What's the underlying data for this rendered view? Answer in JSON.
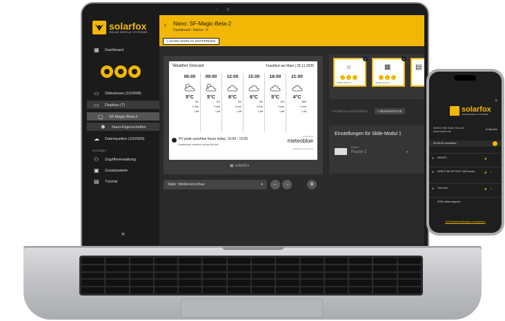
{
  "app": {
    "logo_word": "solarfox",
    "logo_sub": "SOLAR DISPLAY SYSTEMS",
    "brand_color": "#f2b705"
  },
  "sidebar": {
    "dashboard": "Dashboard",
    "slideshows": "Slideshows (10/2008)",
    "displays": "Displays (7)",
    "display_selected": "SF-Magic-Beta-2",
    "nano_props": "Nano-Eigenschaften",
    "datasources": "Datenquellen (10/2009)",
    "section_other": "Sonstiges",
    "access": "Zugriffsverwaltung",
    "packages": "Zusatzpakete",
    "tutorial": "Tutorial",
    "collapse": "«"
  },
  "header": {
    "back": "‹",
    "title": "Nano: SF-Magic-Beta-2",
    "breadcrumb": "Dashboard › Nanos › 9",
    "remove_button": "NANO-DISPLAY ENTFERNEN"
  },
  "weather": {
    "title": "Weather forecast",
    "location_date": "Frankfurt am Main | 25.11.2025",
    "columns": [
      {
        "time": "06:00",
        "temp": "5°C",
        "rain_pct": "0%",
        "rain_mm": "0 mm",
        "wind": "1 bft",
        "icon": "cloud-sun"
      },
      {
        "time": "09:00",
        "temp": "5°C",
        "rain_pct": "0%",
        "rain_mm": "0 mm",
        "wind": "1 bft",
        "icon": "cloud-sun"
      },
      {
        "time": "12:00",
        "temp": "6°C",
        "rain_pct": "0%",
        "rain_mm": "0 mm",
        "wind": "1 bft",
        "icon": "cloud"
      },
      {
        "time": "15:00",
        "temp": "6°C",
        "rain_pct": "0%",
        "rain_mm": "0 mm",
        "wind": "1 bft",
        "icon": "cloud"
      },
      {
        "time": "18:00",
        "temp": "5°C",
        "rain_pct": "0%",
        "rain_mm": "0 mm",
        "wind": "1 bft",
        "icon": "cloud"
      },
      {
        "time": "21:00",
        "temp": "4°C",
        "rain_pct": "25%",
        "rain_mm": "0 mm",
        "wind": "1 bft",
        "icon": "cloud"
      }
    ],
    "footer_main": "PV peak sunshine hours today: 10:00 - 15:00.",
    "footer_sub": "Quasitrange sunshine during this time",
    "provider_pre": "powered by",
    "provider": "meteoblue",
    "provider_sub": "A Meteoium Company",
    "frame_brand": "solarfox"
  },
  "controls": {
    "slide_select": "Slide: Wettervorschau",
    "slide_caret": "▾",
    "prev": "←",
    "next": "→",
    "present": "⧉"
  },
  "thumbnails": [
    {
      "badge": "1",
      "source": "Quelle: Demo 0",
      "symbol": "☼"
    },
    {
      "badge": "2",
      "source": "Quelle: Demo 2",
      "symbol": "▦"
    },
    {
      "badge": "",
      "source": "",
      "symbol": "▤"
    }
  ],
  "thumbnail_actions": {
    "add": "+ SLIDE(S) HINZUFÜGEN",
    "flow": "+ REIHENFOLGE"
  },
  "settings": {
    "title": "Einstellungen für Slide-Modul 1",
    "raster_label": "Raster *",
    "raster_value": "Raster 1",
    "raster_caret": "▾"
  },
  "phone": {
    "close": "×",
    "hint": "Weitere Hilfe finden Sie unter www.solarfox.de",
    "language": "⊕ Sprache",
    "wifi_select": "Mit WLAN auswählen",
    "networks": [
      {
        "name": "3934470",
        "locked": false
      },
      {
        "name": "DIRECT-BE-HP ENVY 4520 series",
        "locked": true
      },
      {
        "name": "LAN-Vodi",
        "locked": true
      }
    ],
    "ssid_manual": "SSID selbst eingeben",
    "bottom_link": "Auf Werkseinstellungen zurücksetzen"
  }
}
